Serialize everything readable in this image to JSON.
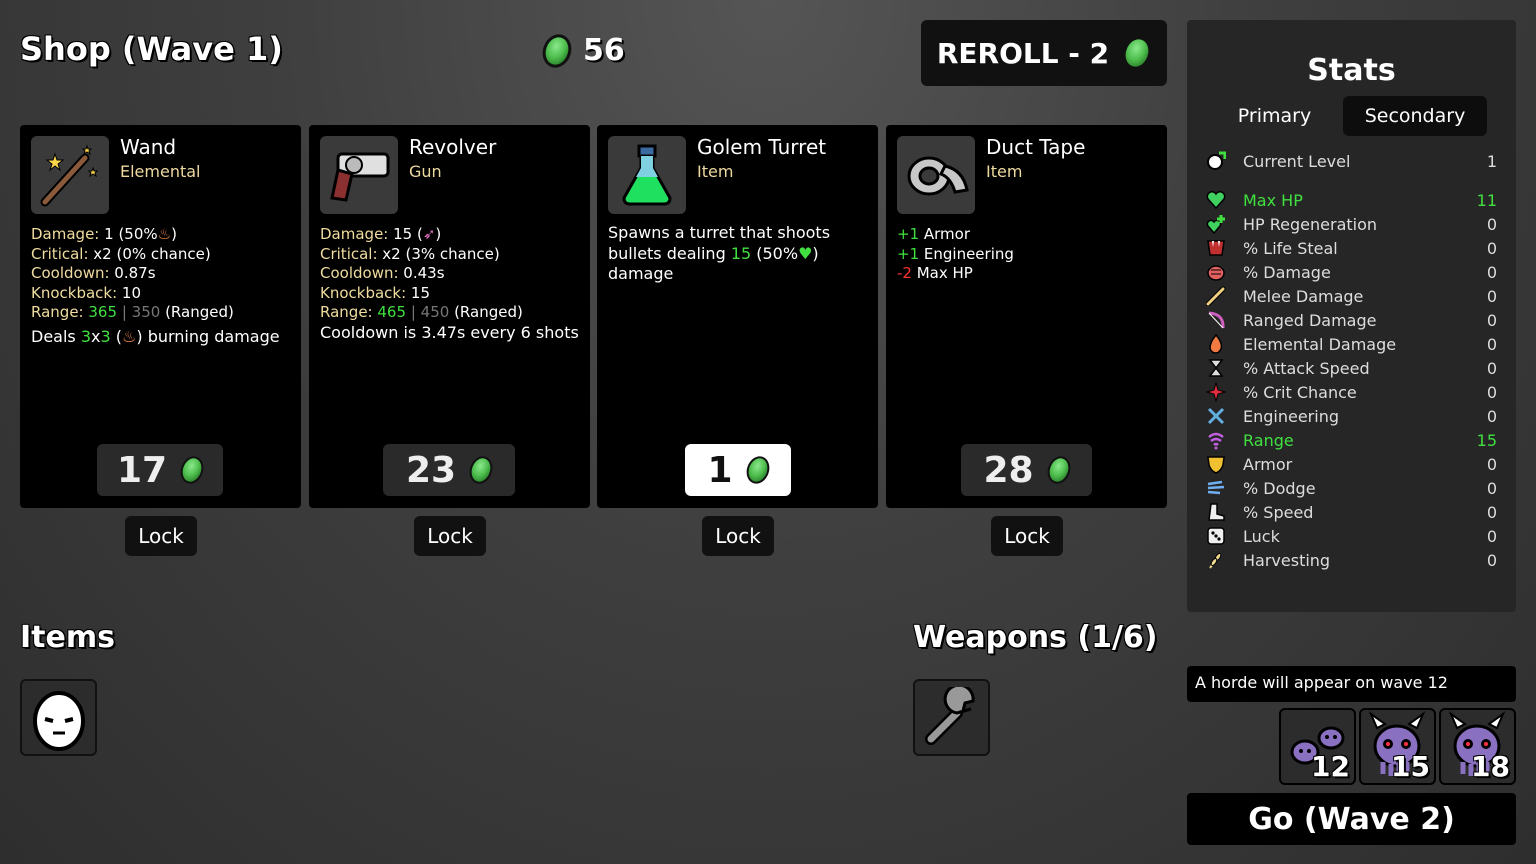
{
  "header": {
    "shop_title": "Shop (Wave 1)",
    "materials": "56",
    "reroll_label": "REROLL - 2"
  },
  "shop_cards": [
    {
      "name": "Wand",
      "type": "Elemental",
      "icon": "wand-icon",
      "stats": {
        "damage_k": "Damage:",
        "damage_v": " 1 (50%",
        "critical_k": "Critical:",
        "critical_v": " x2 (0% chance)",
        "cooldown_k": "Cooldown:",
        "cooldown_v": " 0.87s",
        "knockback_k": "Knockback:",
        "knockback_v": " 10",
        "range_k": "Range:",
        "range_now": "365",
        "range_base": "350",
        "range_suffix": " (Ranged)",
        "extra_a": "Deals ",
        "extra_b": "3",
        "extra_c": "x",
        "extra_d": "3",
        "extra_e": " (",
        "extra_f": ") burning damage"
      },
      "price": "17",
      "lock_label": "Lock"
    },
    {
      "name": "Revolver",
      "type": "Gun",
      "icon": "revolver-icon",
      "stats": {
        "damage_k": "Damage:",
        "damage_v": " 15 (",
        "critical_k": "Critical:",
        "critical_v": " x2 (3% chance)",
        "cooldown_k": "Cooldown:",
        "cooldown_v": " 0.43s",
        "knockback_k": "Knockback:",
        "knockback_v": " 15",
        "range_k": "Range:",
        "range_now": "465",
        "range_base": "450",
        "range_suffix": " (Ranged)",
        "extra": "Cooldown is 3.47s every 6 shots"
      },
      "price": "23",
      "lock_label": "Lock"
    },
    {
      "name": "Golem Turret",
      "type": "Item",
      "icon": "potion-icon",
      "desc_a": "Spawns a turret that shoots bullets dealing ",
      "desc_b": "15",
      "desc_c": " (50%",
      "desc_d": ") damage",
      "price": "1",
      "lock_label": "Lock"
    },
    {
      "name": "Duct Tape",
      "type": "Item",
      "icon": "duct-tape-icon",
      "effects": [
        {
          "amount": "+1",
          "label": " Armor",
          "color": "#40e040"
        },
        {
          "amount": "+1",
          "label": " Engineering",
          "color": "#40e040"
        },
        {
          "amount": "-2",
          "label": " Max HP",
          "color": "#ff3333"
        }
      ],
      "price": "28",
      "lock_label": "Lock"
    }
  ],
  "items_title": "Items",
  "weapons_title": "Weapons (1/6)",
  "stats_panel": {
    "title": "Stats",
    "tab_primary": "Primary",
    "tab_secondary": "Secondary",
    "rows": [
      {
        "label": "Current Level",
        "value": "1",
        "icon": "level-up-icon"
      },
      {
        "label": "Max HP",
        "value": "11",
        "icon": "heart-icon",
        "highlight": true
      },
      {
        "label": "HP Regeneration",
        "value": "0",
        "icon": "hp-regen-icon"
      },
      {
        "label": "% Life Steal",
        "value": "0",
        "icon": "life-steal-icon"
      },
      {
        "label": "% Damage",
        "value": "0",
        "icon": "damage-fist-icon"
      },
      {
        "label": "Melee Damage",
        "value": "0",
        "icon": "sword-icon"
      },
      {
        "label": "Ranged Damage",
        "value": "0",
        "icon": "bow-icon"
      },
      {
        "label": "Elemental Damage",
        "value": "0",
        "icon": "flame-icon"
      },
      {
        "label": "% Attack Speed",
        "value": "0",
        "icon": "hourglass-icon"
      },
      {
        "label": "% Crit Chance",
        "value": "0",
        "icon": "crit-icon"
      },
      {
        "label": "Engineering",
        "value": "0",
        "icon": "wrench-cross-icon"
      },
      {
        "label": "Range",
        "value": "15",
        "icon": "range-signal-icon",
        "highlight": true
      },
      {
        "label": "Armor",
        "value": "0",
        "icon": "shield-icon"
      },
      {
        "label": "% Dodge",
        "value": "0",
        "icon": "dodge-icon"
      },
      {
        "label": "% Speed",
        "value": "0",
        "icon": "speed-boot-icon"
      },
      {
        "label": "Luck",
        "value": "0",
        "icon": "dice-icon"
      },
      {
        "label": "Harvesting",
        "value": "0",
        "icon": "wheat-icon"
      }
    ]
  },
  "horde_notice": "A horde will appear on wave 12",
  "enemies": [
    {
      "count": "12",
      "icon": "slime-pair-icon"
    },
    {
      "count": "15",
      "icon": "horned-alien-icon"
    },
    {
      "count": "18",
      "icon": "horned-alien-icon"
    }
  ],
  "go_label": "Go (Wave 2)",
  "colors": {
    "highlight_green": "#40e040",
    "negative_red": "#ff3333",
    "stat_key": "#f0dca0",
    "type_label": "#eed9a0"
  }
}
